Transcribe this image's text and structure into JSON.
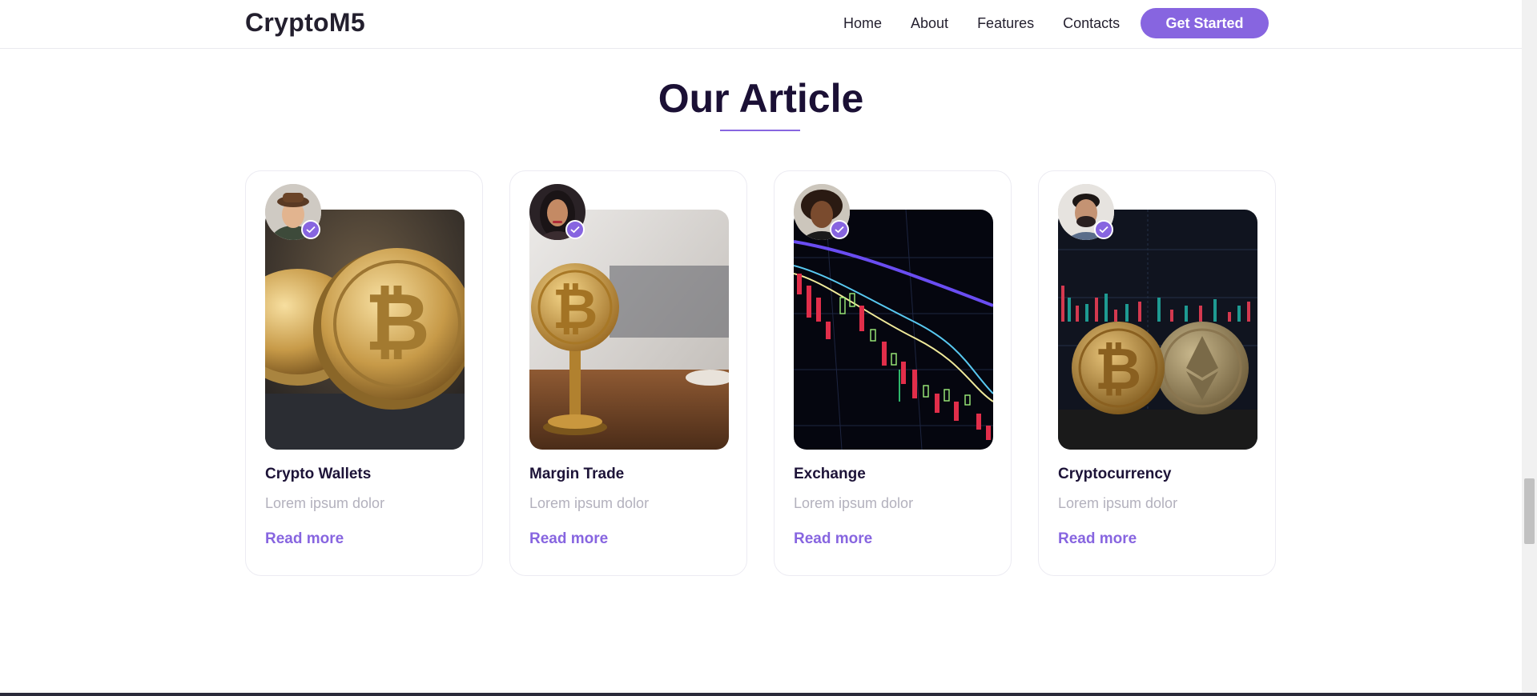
{
  "brand": {
    "logo": "CryptoM5"
  },
  "nav": {
    "items": [
      "Home",
      "About",
      "Features",
      "Contacts"
    ],
    "cta_label": "Get Started"
  },
  "section": {
    "title": "Our Article"
  },
  "articles": [
    {
      "title": "Crypto Wallets",
      "text": "Lorem ipsum dolor",
      "link": "Read more"
    },
    {
      "title": "Margin Trade",
      "text": "Lorem ipsum dolor",
      "link": "Read more"
    },
    {
      "title": "Exchange",
      "text": "Lorem ipsum dolor",
      "link": "Read more"
    },
    {
      "title": "Cryptocurrency",
      "text": "Lorem ipsum dolor",
      "link": "Read more"
    }
  ],
  "colors": {
    "accent": "#8765e0",
    "heading": "#1b1035",
    "muted": "#b3b1bd"
  },
  "icons": [
    "check-icon",
    "vertical-scrollbar"
  ]
}
